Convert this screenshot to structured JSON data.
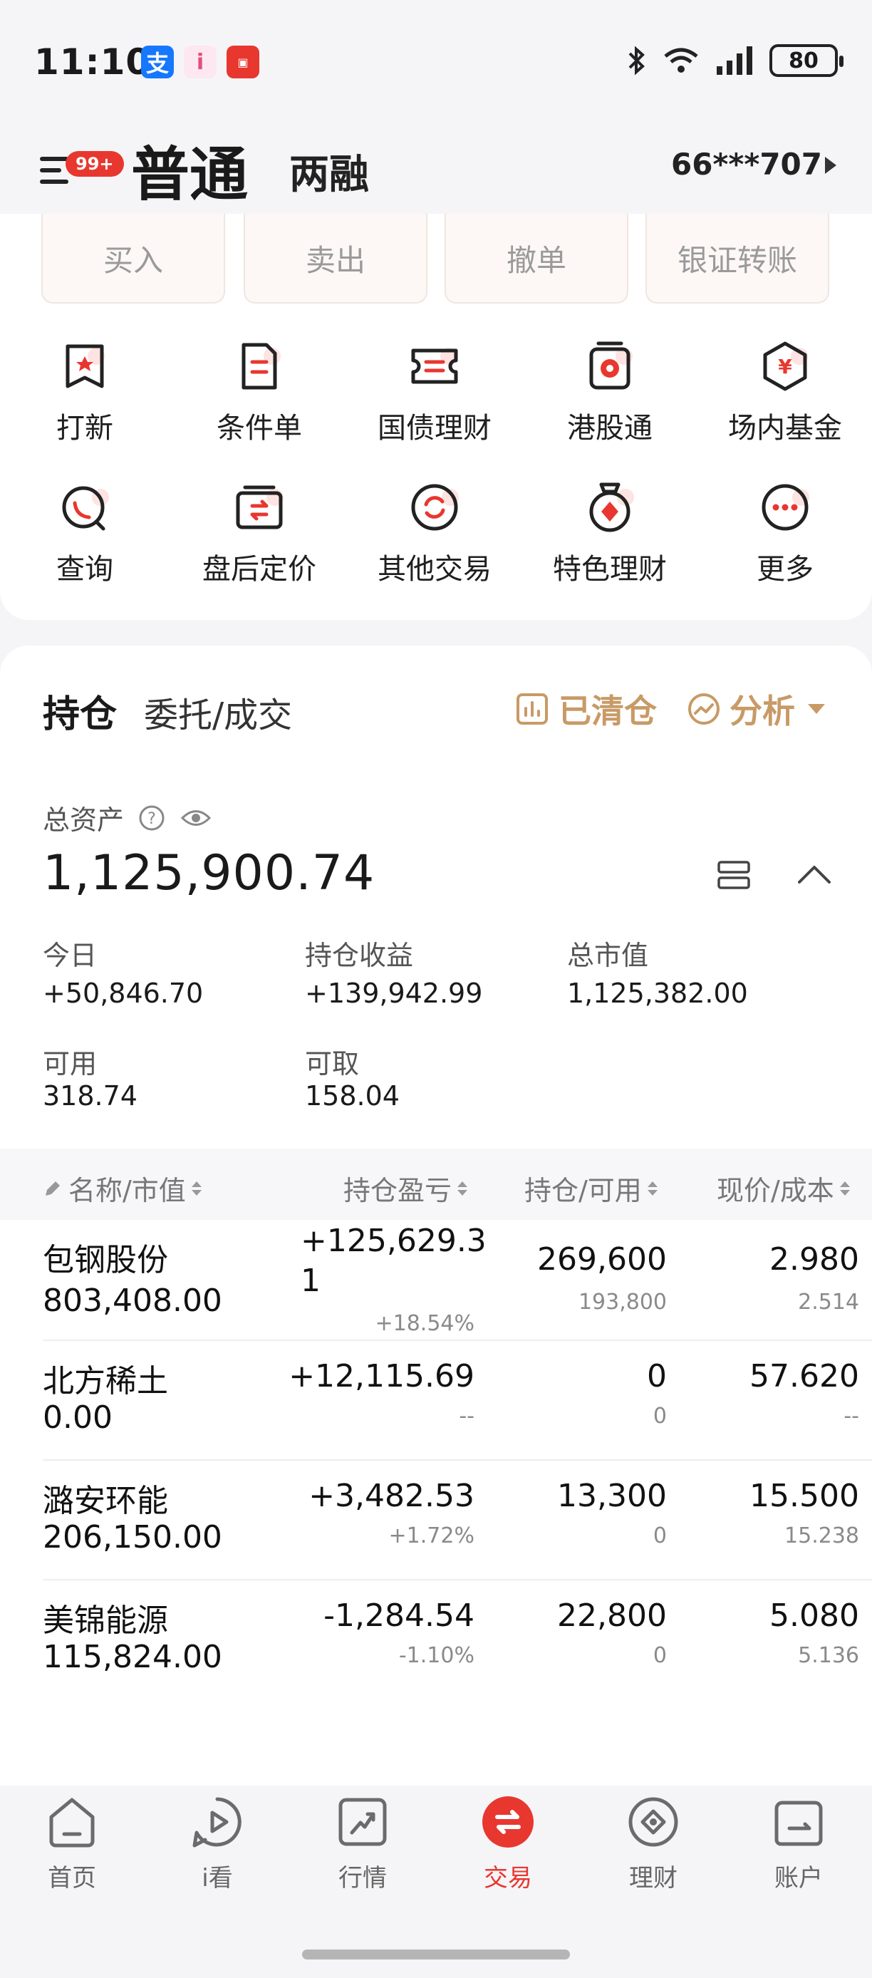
{
  "status_bar": {
    "time": "11:10",
    "battery": "80"
  },
  "header": {
    "active_tab": "普通",
    "tab2": "两融",
    "badge": "99+",
    "account": "66***707"
  },
  "actions": [
    "买入",
    "卖出",
    "撤单",
    "银证转账"
  ],
  "grid": [
    {
      "label": "打新",
      "icon": "ipo-icon"
    },
    {
      "label": "条件单",
      "icon": "condition-order-icon"
    },
    {
      "label": "国债理财",
      "icon": "treasury-icon"
    },
    {
      "label": "港股通",
      "icon": "hk-connect-icon"
    },
    {
      "label": "场内基金",
      "icon": "exchange-fund-icon"
    },
    {
      "label": "查询",
      "icon": "query-icon"
    },
    {
      "label": "盘后定价",
      "icon": "after-hours-icon"
    },
    {
      "label": "其他交易",
      "icon": "other-trade-icon"
    },
    {
      "label": "特色理财",
      "icon": "featured-wealth-icon"
    },
    {
      "label": "更多",
      "icon": "more-icon"
    }
  ],
  "holdings_tabs": {
    "active": "持仓",
    "other": "委托/成交",
    "cleared": "已清仓",
    "analysis": "分析"
  },
  "summary": {
    "total_label": "总资产",
    "total_value": "1,125,900.74",
    "today_label": "今日",
    "today_value": "+50,846.70",
    "pnl_label": "持仓收益",
    "pnl_value": "+139,942.99",
    "mv_label": "总市值",
    "mv_value": "1,125,382.00",
    "avail_label": "可用",
    "avail_value": "318.74",
    "withdraw_label": "可取",
    "withdraw_value": "158.04"
  },
  "table": {
    "headers": [
      "名称/市值",
      "持仓盈亏",
      "持仓/可用",
      "现价/成本"
    ],
    "rows": [
      {
        "name": "包钢股份",
        "mv": "803,408.00",
        "pnl_line1": "+125,629.3",
        "pnl_line2": "1",
        "pnl_pct": "+18.54%",
        "qty": "269,600",
        "avail": "193,800",
        "price": "2.980",
        "cost": "2.514",
        "dir": "up"
      },
      {
        "name": "北方稀土",
        "mv": "0.00",
        "pnl_line1": "+12,115.69",
        "pnl_line2": "",
        "pnl_pct": "--",
        "qty": "0",
        "avail": "0",
        "price": "57.620",
        "cost": "--",
        "dir": "up"
      },
      {
        "name": "潞安环能",
        "mv": "206,150.00",
        "pnl_line1": "+3,482.53",
        "pnl_line2": "",
        "pnl_pct": "+1.72%",
        "qty": "13,300",
        "avail": "0",
        "price": "15.500",
        "cost": "15.238",
        "dir": "up"
      },
      {
        "name": "美锦能源",
        "mv": "115,824.00",
        "pnl_line1": "-1,284.54",
        "pnl_line2": "",
        "pnl_pct": "-1.10%",
        "qty": "22,800",
        "avail": "0",
        "price": "5.080",
        "cost": "5.136",
        "dir": "down"
      }
    ]
  },
  "nav": [
    {
      "label": "首页",
      "icon": "home-icon"
    },
    {
      "label": "i看",
      "icon": "play-icon"
    },
    {
      "label": "行情",
      "icon": "market-icon"
    },
    {
      "label": "交易",
      "icon": "trade-icon"
    },
    {
      "label": "理财",
      "icon": "wealth-icon"
    },
    {
      "label": "账户",
      "icon": "account-icon"
    }
  ],
  "colors": {
    "red": "#e2373f",
    "green": "#11a05a",
    "gold": "#c89a66",
    "active_nav": "#e8372f"
  }
}
